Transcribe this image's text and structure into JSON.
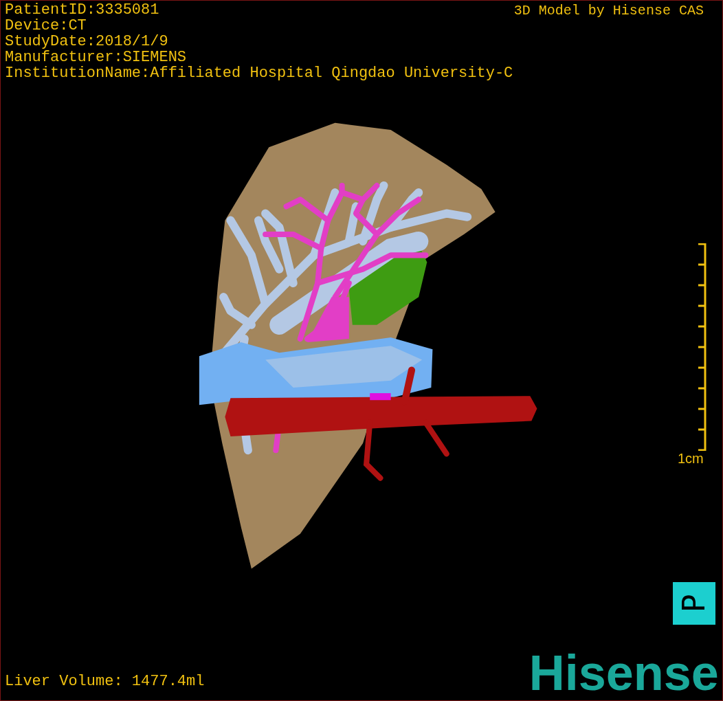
{
  "info_lines": [
    "PatientID:3335081",
    "Device:CT",
    "StudyDate:2018/1/9",
    "Manufacturer:SIEMENS",
    "InstitutionName:Affiliated Hospital Qingdao University-C"
  ],
  "title": "3D Model by Hisense CAS",
  "scale_bar": {
    "label": "1cm"
  },
  "orientation_marker": "P",
  "liver_volume": "Liver Volume: 1477.4ml",
  "logo": "Hisense"
}
